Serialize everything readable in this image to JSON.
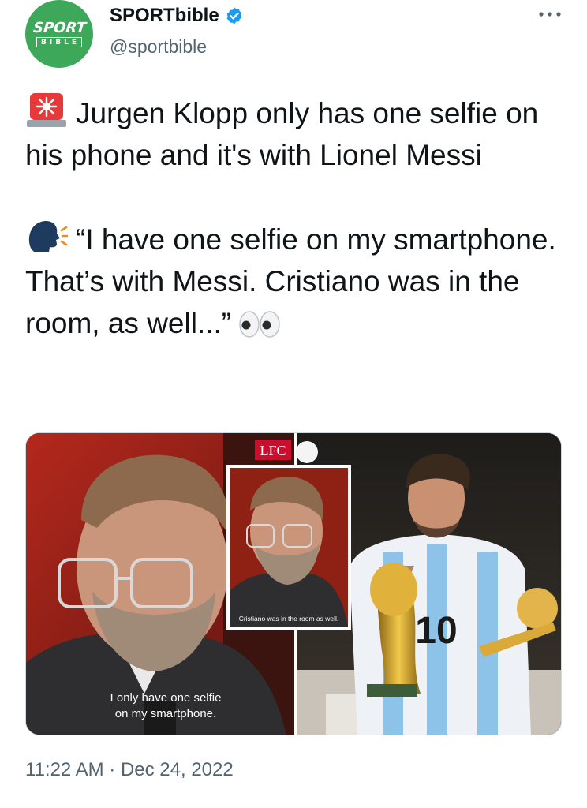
{
  "author": {
    "avatar_text_top": "SPORT",
    "avatar_text_bottom": "BIBLE",
    "display_name": "SPORTbible",
    "handle": "@sportbible",
    "verified": true
  },
  "icons": [
    "verified-badge-icon",
    "more-options-icon",
    "police-light-emoji",
    "speaking-head-emoji",
    "eyes-emoji"
  ],
  "tweet": {
    "paragraph1": "Jurgen Klopp only has one selfie on his phone and it's with Lionel Messi",
    "paragraph2": "“I have one selfie on my smartphone. That’s with Messi. Cristiano was in the room, as well...”"
  },
  "media": {
    "left_caption_line1": "I only have one selfie",
    "left_caption_line2": "on my smartphone.",
    "inset_caption": "Cristiano was in the room as well.",
    "channel_logo": "LFC",
    "shirt_number": "10"
  },
  "meta": {
    "time": "11:22 AM",
    "separator": " · ",
    "date": "Dec 24, 2022"
  },
  "colors": {
    "avatar_green": "#3ea85a",
    "verified_blue": "#1d9bf0",
    "secondary_text": "#536471"
  }
}
